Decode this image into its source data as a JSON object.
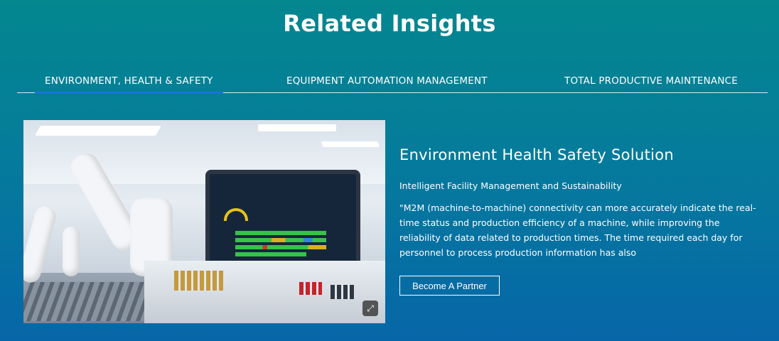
{
  "section": {
    "title": "Related Insights"
  },
  "tabs": [
    {
      "label": "ENVIRONMENT, HEALTH & SAFETY",
      "active": true
    },
    {
      "label": "EQUIPMENT AUTOMATION MANAGEMENT",
      "active": false
    },
    {
      "label": "TOTAL PRODUCTIVE MAINTENANCE",
      "active": false
    }
  ],
  "card": {
    "heading": "Environment Health Safety Solution",
    "subheading": "Intelligent Facility Management and Sustainability",
    "body": "\"M2M (machine-to-machine) connectivity can more accurately indicate the real-time status and production efficiency of a machine, while improving the reliability of data related to production times. The time required each day for personnel to process production information has also",
    "cta_label": "Become A Partner",
    "image_icon": "expand-icon"
  },
  "colors": {
    "bg_top": "#04878f",
    "bg_bottom": "#0766a8",
    "tab_underline": "#1a74d8",
    "text": "#ffffff"
  }
}
